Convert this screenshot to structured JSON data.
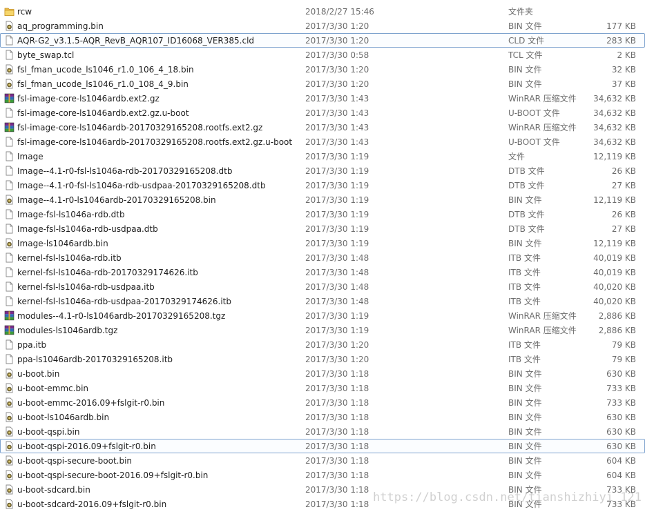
{
  "files": [
    {
      "name": "rcw",
      "date": "2018/2/27 15:46",
      "type": "文件夹",
      "size": "",
      "icon": "folder-icon"
    },
    {
      "name": "aq_programming.bin",
      "date": "2017/3/30 1:20",
      "type": "BIN 文件",
      "size": "177 KB",
      "icon": "bin-file-icon"
    },
    {
      "name": "AQR-G2_v3.1.5-AQR_RevB_AQR107_ID16068_VER385.cld",
      "date": "2017/3/30 1:20",
      "type": "CLD 文件",
      "size": "283 KB",
      "icon": "blank-file-icon",
      "highlighted": true
    },
    {
      "name": "byte_swap.tcl",
      "date": "2017/3/30 0:58",
      "type": "TCL 文件",
      "size": "2 KB",
      "icon": "blank-file-icon"
    },
    {
      "name": "fsl_fman_ucode_ls1046_r1.0_106_4_18.bin",
      "date": "2017/3/30 1:20",
      "type": "BIN 文件",
      "size": "32 KB",
      "icon": "bin-file-icon"
    },
    {
      "name": "fsl_fman_ucode_ls1046_r1.0_108_4_9.bin",
      "date": "2017/3/30 1:20",
      "type": "BIN 文件",
      "size": "37 KB",
      "icon": "bin-file-icon"
    },
    {
      "name": "fsl-image-core-ls1046ardb.ext2.gz",
      "date": "2017/3/30 1:43",
      "type": "WinRAR 压缩文件",
      "size": "34,632 KB",
      "icon": "winrar-archive-icon"
    },
    {
      "name": "fsl-image-core-ls1046ardb.ext2.gz.u-boot",
      "date": "2017/3/30 1:43",
      "type": "U-BOOT 文件",
      "size": "34,632 KB",
      "icon": "blank-file-icon"
    },
    {
      "name": "fsl-image-core-ls1046ardb-20170329165208.rootfs.ext2.gz",
      "date": "2017/3/30 1:43",
      "type": "WinRAR 压缩文件",
      "size": "34,632 KB",
      "icon": "winrar-archive-icon"
    },
    {
      "name": "fsl-image-core-ls1046ardb-20170329165208.rootfs.ext2.gz.u-boot",
      "date": "2017/3/30 1:43",
      "type": "U-BOOT 文件",
      "size": "34,632 KB",
      "icon": "blank-file-icon"
    },
    {
      "name": "Image",
      "date": "2017/3/30 1:19",
      "type": "文件",
      "size": "12,119 KB",
      "icon": "blank-file-icon"
    },
    {
      "name": "Image--4.1-r0-fsl-ls1046a-rdb-20170329165208.dtb",
      "date": "2017/3/30 1:19",
      "type": "DTB 文件",
      "size": "26 KB",
      "icon": "blank-file-icon"
    },
    {
      "name": "Image--4.1-r0-fsl-ls1046a-rdb-usdpaa-20170329165208.dtb",
      "date": "2017/3/30 1:19",
      "type": "DTB 文件",
      "size": "27 KB",
      "icon": "blank-file-icon"
    },
    {
      "name": "Image--4.1-r0-ls1046ardb-20170329165208.bin",
      "date": "2017/3/30 1:19",
      "type": "BIN 文件",
      "size": "12,119 KB",
      "icon": "bin-file-icon"
    },
    {
      "name": "Image-fsl-ls1046a-rdb.dtb",
      "date": "2017/3/30 1:19",
      "type": "DTB 文件",
      "size": "26 KB",
      "icon": "blank-file-icon"
    },
    {
      "name": "Image-fsl-ls1046a-rdb-usdpaa.dtb",
      "date": "2017/3/30 1:19",
      "type": "DTB 文件",
      "size": "27 KB",
      "icon": "blank-file-icon"
    },
    {
      "name": "Image-ls1046ardb.bin",
      "date": "2017/3/30 1:19",
      "type": "BIN 文件",
      "size": "12,119 KB",
      "icon": "bin-file-icon"
    },
    {
      "name": "kernel-fsl-ls1046a-rdb.itb",
      "date": "2017/3/30 1:48",
      "type": "ITB 文件",
      "size": "40,019 KB",
      "icon": "blank-file-icon"
    },
    {
      "name": "kernel-fsl-ls1046a-rdb-20170329174626.itb",
      "date": "2017/3/30 1:48",
      "type": "ITB 文件",
      "size": "40,019 KB",
      "icon": "blank-file-icon"
    },
    {
      "name": "kernel-fsl-ls1046a-rdb-usdpaa.itb",
      "date": "2017/3/30 1:48",
      "type": "ITB 文件",
      "size": "40,020 KB",
      "icon": "blank-file-icon"
    },
    {
      "name": "kernel-fsl-ls1046a-rdb-usdpaa-20170329174626.itb",
      "date": "2017/3/30 1:48",
      "type": "ITB 文件",
      "size": "40,020 KB",
      "icon": "blank-file-icon"
    },
    {
      "name": "modules--4.1-r0-ls1046ardb-20170329165208.tgz",
      "date": "2017/3/30 1:19",
      "type": "WinRAR 压缩文件",
      "size": "2,886 KB",
      "icon": "winrar-archive-icon"
    },
    {
      "name": "modules-ls1046ardb.tgz",
      "date": "2017/3/30 1:19",
      "type": "WinRAR 压缩文件",
      "size": "2,886 KB",
      "icon": "winrar-archive-icon"
    },
    {
      "name": "ppa.itb",
      "date": "2017/3/30 1:20",
      "type": "ITB 文件",
      "size": "79 KB",
      "icon": "blank-file-icon"
    },
    {
      "name": "ppa-ls1046ardb-20170329165208.itb",
      "date": "2017/3/30 1:20",
      "type": "ITB 文件",
      "size": "79 KB",
      "icon": "blank-file-icon"
    },
    {
      "name": "u-boot.bin",
      "date": "2017/3/30 1:18",
      "type": "BIN 文件",
      "size": "630 KB",
      "icon": "bin-file-icon"
    },
    {
      "name": "u-boot-emmc.bin",
      "date": "2017/3/30 1:18",
      "type": "BIN 文件",
      "size": "733 KB",
      "icon": "bin-file-icon"
    },
    {
      "name": "u-boot-emmc-2016.09+fslgit-r0.bin",
      "date": "2017/3/30 1:18",
      "type": "BIN 文件",
      "size": "733 KB",
      "icon": "bin-file-icon"
    },
    {
      "name": "u-boot-ls1046ardb.bin",
      "date": "2017/3/30 1:18",
      "type": "BIN 文件",
      "size": "630 KB",
      "icon": "bin-file-icon"
    },
    {
      "name": "u-boot-qspi.bin",
      "date": "2017/3/30 1:18",
      "type": "BIN 文件",
      "size": "630 KB",
      "icon": "bin-file-icon"
    },
    {
      "name": "u-boot-qspi-2016.09+fslgit-r0.bin",
      "date": "2017/3/30 1:18",
      "type": "BIN 文件",
      "size": "630 KB",
      "icon": "bin-file-icon",
      "highlighted": true
    },
    {
      "name": "u-boot-qspi-secure-boot.bin",
      "date": "2017/3/30 1:18",
      "type": "BIN 文件",
      "size": "604 KB",
      "icon": "bin-file-icon"
    },
    {
      "name": "u-boot-qspi-secure-boot-2016.09+fslgit-r0.bin",
      "date": "2017/3/30 1:18",
      "type": "BIN 文件",
      "size": "604 KB",
      "icon": "bin-file-icon"
    },
    {
      "name": "u-boot-sdcard.bin",
      "date": "2017/3/30 1:18",
      "type": "BIN 文件",
      "size": "733 KB",
      "icon": "bin-file-icon"
    },
    {
      "name": "u-boot-sdcard-2016.09+fslgit-r0.bin",
      "date": "2017/3/30 1:18",
      "type": "BIN 文件",
      "size": "733 KB",
      "icon": "bin-file-icon"
    }
  ],
  "watermark": "https://blog.csdn.net/tianshizhiyi_121"
}
